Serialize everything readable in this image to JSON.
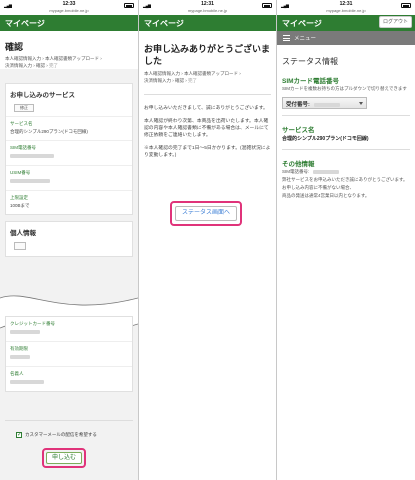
{
  "panel1": {
    "status": {
      "time": "12:33",
      "url": "mypage.bmobile.ne.jp"
    },
    "app_title": "マイページ",
    "page_title": "確認",
    "breadcrumbs": [
      "本人確認情報入力",
      "本人確認書類アップロード",
      "決済情報入力",
      "確認",
      "完了"
    ],
    "services_heading": "お申し込みのサービス",
    "edit_label": "修正",
    "service_label": "サービス名",
    "service_value": "合理的シンプル290プラン(ドコモ回線)",
    "sim_label": "SIM電話番号",
    "usim_label": "USIM番号",
    "limit_label": "上限設定",
    "limit_value": "100Bまで",
    "personal_heading": "個人情報",
    "card_label": "クレジットカード番号",
    "expiry_label": "有効期限",
    "holder_label": "名義人",
    "newsletter_label": "カスタマーメールの配信を希望する",
    "submit_label": "申し込む"
  },
  "panel2": {
    "status": {
      "time": "12:31",
      "url": "mypage.bmobile.ne.jp"
    },
    "app_title": "マイページ",
    "title": "お申し込みありがとうございました",
    "breadcrumbs": [
      "本人確認情報入力",
      "本人確認書類アップロード",
      "決済情報入力",
      "確認",
      "完了"
    ],
    "para1": "お申し込みいただきまして、誠にありがとうございます。",
    "para2": "本人確認が終わり次第、本商品を出荷いたします。本人確認の内容や本人確認書類に不備がある場合は、メールにて修正依頼をご連絡いたします。",
    "para3": "※本人確認の完了まで1日〜5日かかります。(混雑状況により変動します。)",
    "status_button": "ステータス画面へ"
  },
  "panel3": {
    "status": {
      "time": "12:31",
      "url": "mypage.bmobile.ne.jp"
    },
    "app_title": "マイページ",
    "login_button": "ログアウト",
    "menu_label": "メニュー",
    "title": "ステータス情報",
    "sim_heading": "SIMカード電話番号",
    "sim_note": "SIMカードを複数お持ちの方はプルダウンで切り替えできます",
    "select_label": "受付番号:",
    "service_heading": "サービス名",
    "service_value": "合理的シンプル290プラン(ドコモ回線)",
    "other_heading": "その他情報",
    "other_phone_label": "SIM電話番号:",
    "other_line1": "弊社サービスをお申込みいただき誠にありがとうございます。",
    "other_line2": "お申し込み内容に不備がない場合、",
    "other_line3": "商品の発送は通常4営業日以内となります。"
  },
  "colors": {
    "brand_green": "#2e7d32",
    "highlight": "#e0337a",
    "menu_gray": "#7a7a7a"
  }
}
